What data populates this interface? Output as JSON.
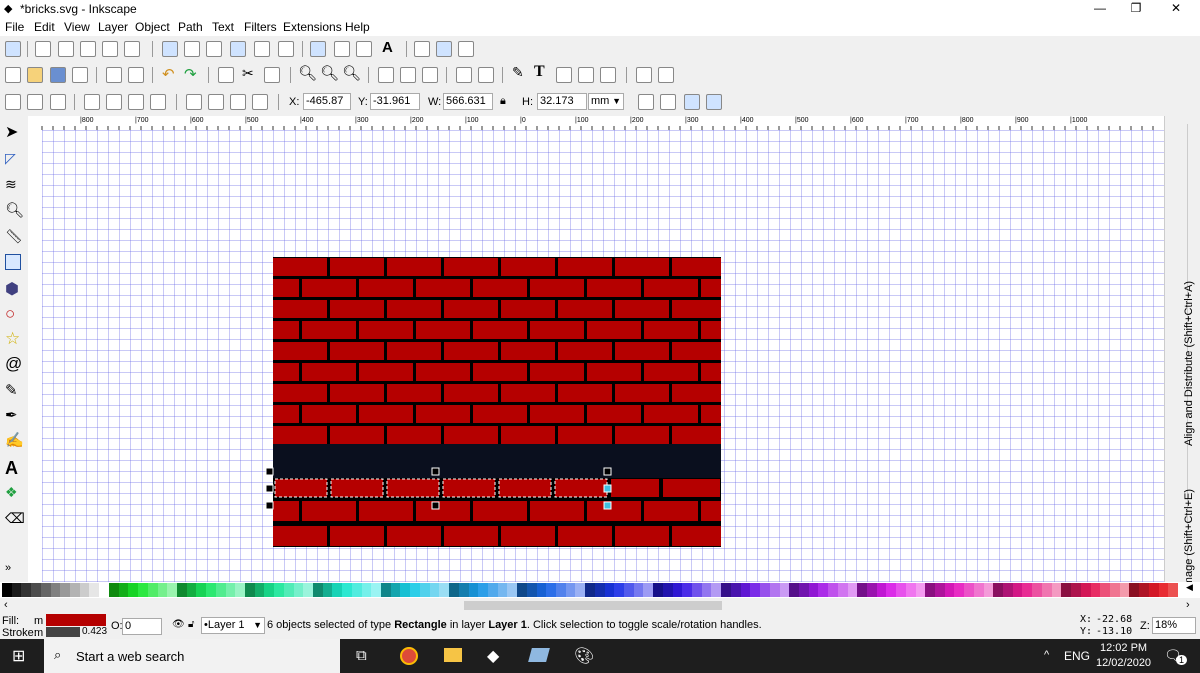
{
  "window": {
    "title": "*bricks.svg - Inkscape",
    "controls": [
      "—",
      "❐",
      "✕"
    ]
  },
  "menu": [
    "File",
    "Edit",
    "View",
    "Layer",
    "Object",
    "Path",
    "Text",
    "Filters",
    "Extensions",
    "Help"
  ],
  "toolbar": {
    "x_label": "X:",
    "x_value": "-465.87",
    "y_label": "Y:",
    "y_value": "-31.961",
    "w_label": "W:",
    "w_value": "566.631",
    "h_label": "H:",
    "h_value": "32.173",
    "unit": "mm",
    "lock_icon": "lock-icon"
  },
  "ruler": {
    "labels": [
      "|800",
      "|700",
      "|600",
      "|500",
      "|400",
      "|300",
      "|200",
      "|100",
      "|0",
      "|100",
      "|200",
      "|300",
      "|400",
      "|500",
      "|600",
      "|700",
      "|800",
      "|900",
      "|1000"
    ]
  },
  "dock": {
    "tab1": "Export PNG Image (Shift+Ctrl+E)",
    "tab2": "Align and Distribute (Shift+Ctrl+A)"
  },
  "canvas": {
    "brick_color": "#b50000",
    "mortar_color": "#000000"
  },
  "status": {
    "fill_label": "Fill:",
    "fill_value": "m",
    "stroke_label": "Stroke:",
    "stroke_value": "m",
    "stroke_width": "0.423",
    "opacity_label": "O:",
    "opacity_value": "0",
    "layer": "•Layer 1",
    "message_parts": [
      "6 objects selected of type ",
      "Rectangle",
      " in layer ",
      "Layer 1",
      ". Click selection to toggle scale/rotation handles."
    ],
    "cursor_x_label": "X:",
    "cursor_x": "-22.68",
    "cursor_y_label": "Y:",
    "cursor_y": "-13.10",
    "zoom_label": "Z:",
    "zoom": "18%"
  },
  "taskbar": {
    "search": "Start a web search",
    "time": "12:02 PM",
    "date": "12/02/2020",
    "lang": "ENG",
    "notification_count": "1"
  }
}
